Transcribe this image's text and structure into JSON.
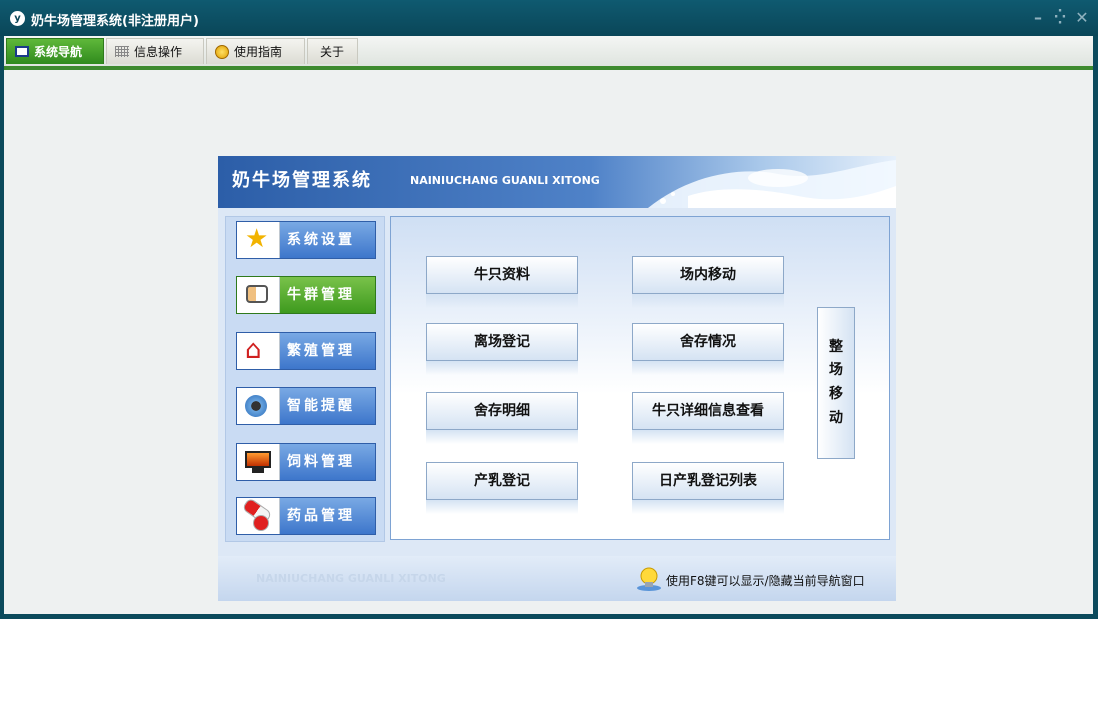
{
  "window": {
    "title": "奶牛场管理系统(非注册用户)",
    "controls": [
      "minimize-icon",
      "restore-icon",
      "close-icon"
    ]
  },
  "menu": {
    "tabs": [
      {
        "label": "系统导航",
        "icon": "monitor-icon",
        "active": true
      },
      {
        "label": "信息操作",
        "icon": "grid-icon",
        "active": false
      },
      {
        "label": "使用指南",
        "icon": "help-circle-icon",
        "active": false
      },
      {
        "label": "关于",
        "icon": "",
        "active": false
      }
    ],
    "accent": "#3e8a2f"
  },
  "panel": {
    "title": "奶牛场管理系统",
    "subtitle": "NAINIUCHANG GUANLI XITONG",
    "nav": [
      {
        "label": "系统设置",
        "icon": "star-icon",
        "active": false
      },
      {
        "label": "牛群管理",
        "icon": "contact-card-icon",
        "active": true
      },
      {
        "label": "繁殖管理",
        "icon": "house-icon",
        "active": false
      },
      {
        "label": "智能提醒",
        "icon": "speaker-icon",
        "active": false
      },
      {
        "label": "饲料管理",
        "icon": "monitor-icon",
        "active": false
      },
      {
        "label": "药品管理",
        "icon": "pills-icon",
        "active": false
      }
    ],
    "actions": [
      {
        "label": "牛只资料"
      },
      {
        "label": "场内移动"
      },
      {
        "label": "离场登记"
      },
      {
        "label": "舍存情况"
      },
      {
        "label": "舍存明细"
      },
      {
        "label": "牛只详细信息查看"
      },
      {
        "label": "产乳登记"
      },
      {
        "label": "日产乳登记列表"
      }
    ],
    "side_action": {
      "chars": [
        "整",
        "场",
        "移",
        "动"
      ]
    },
    "footer": {
      "subtitle": "NAINIUCHANG GUANLI XITONG",
      "hint": "使用F8键可以显示/隐藏当前导航窗口"
    }
  },
  "colors": {
    "titlebar": "#0b4a5c",
    "nav_blue": "#3d76cb",
    "nav_green": "#3e9a1e"
  }
}
